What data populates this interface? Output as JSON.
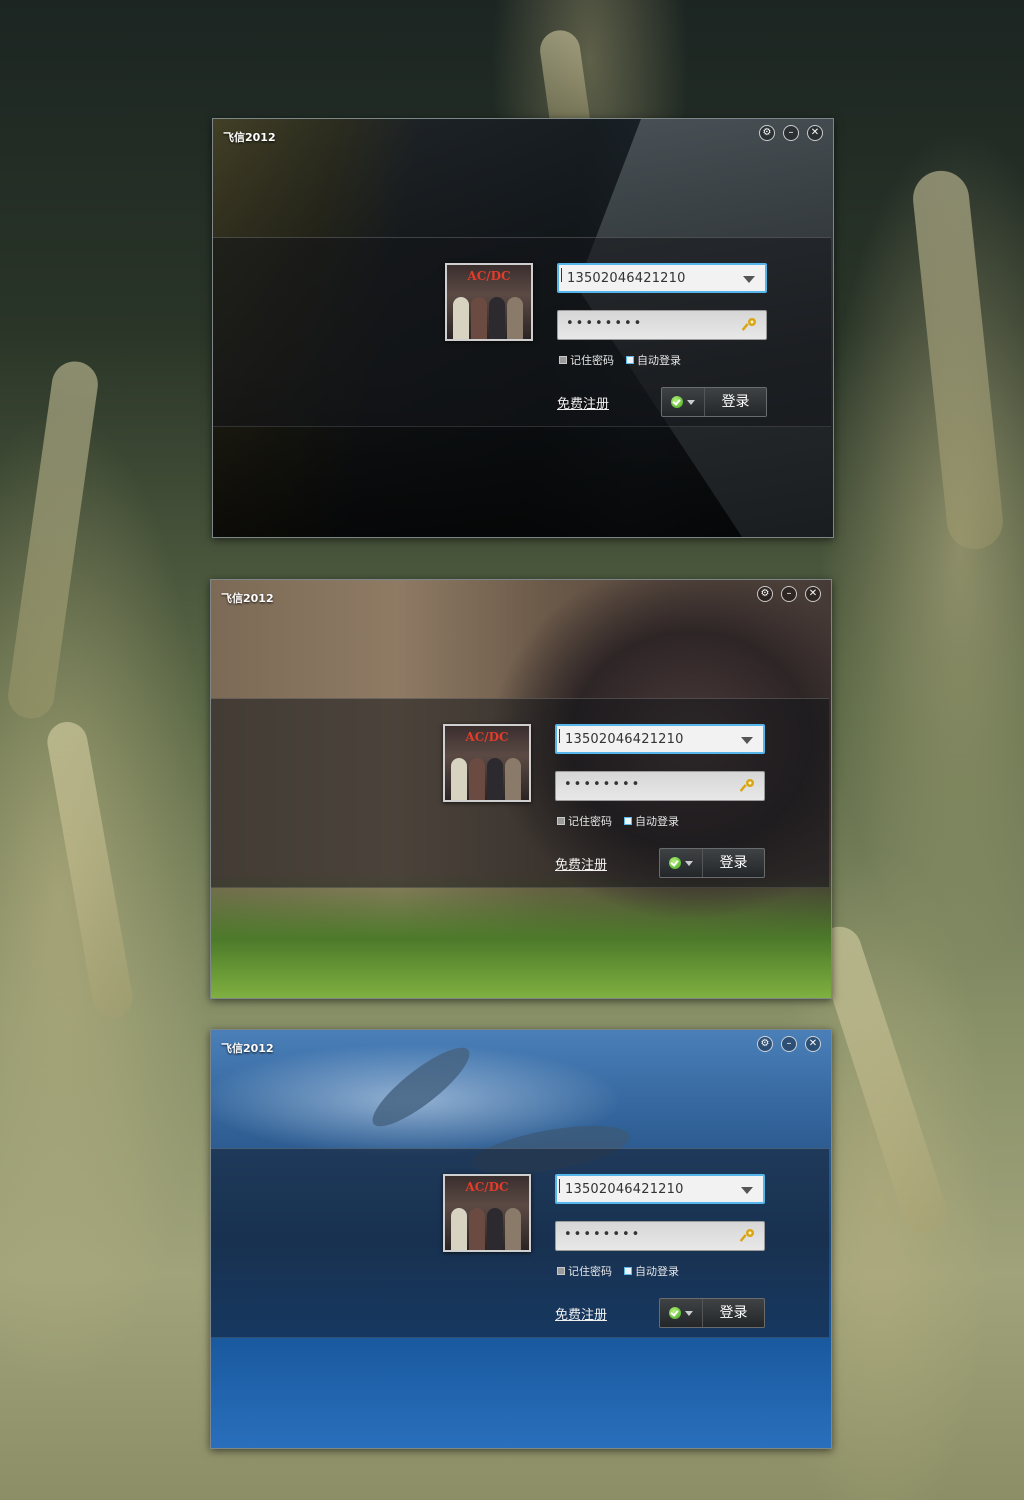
{
  "app": {
    "title": "飞信2012"
  },
  "login": {
    "account": "13502046421210",
    "password_mask": "••••••••",
    "remember_label": "记住密码",
    "auto_login_label": "自动登录",
    "register_label": "免费注册",
    "login_label": "登录",
    "remember_checked": false,
    "auto_login_checked": true,
    "status": "online"
  },
  "avatar": {
    "text": "AC/DC"
  },
  "controls": {
    "settings_icon": "gear-icon",
    "minimize_icon": "minimize-icon",
    "close_icon": "close-icon"
  },
  "colors": {
    "focus_border": "#56b5ea",
    "status_online": "#3fa51e",
    "key_icon": "#d9a514"
  },
  "windows": [
    {
      "theme": "train-station"
    },
    {
      "theme": "monkey"
    },
    {
      "theme": "dolphins"
    }
  ]
}
